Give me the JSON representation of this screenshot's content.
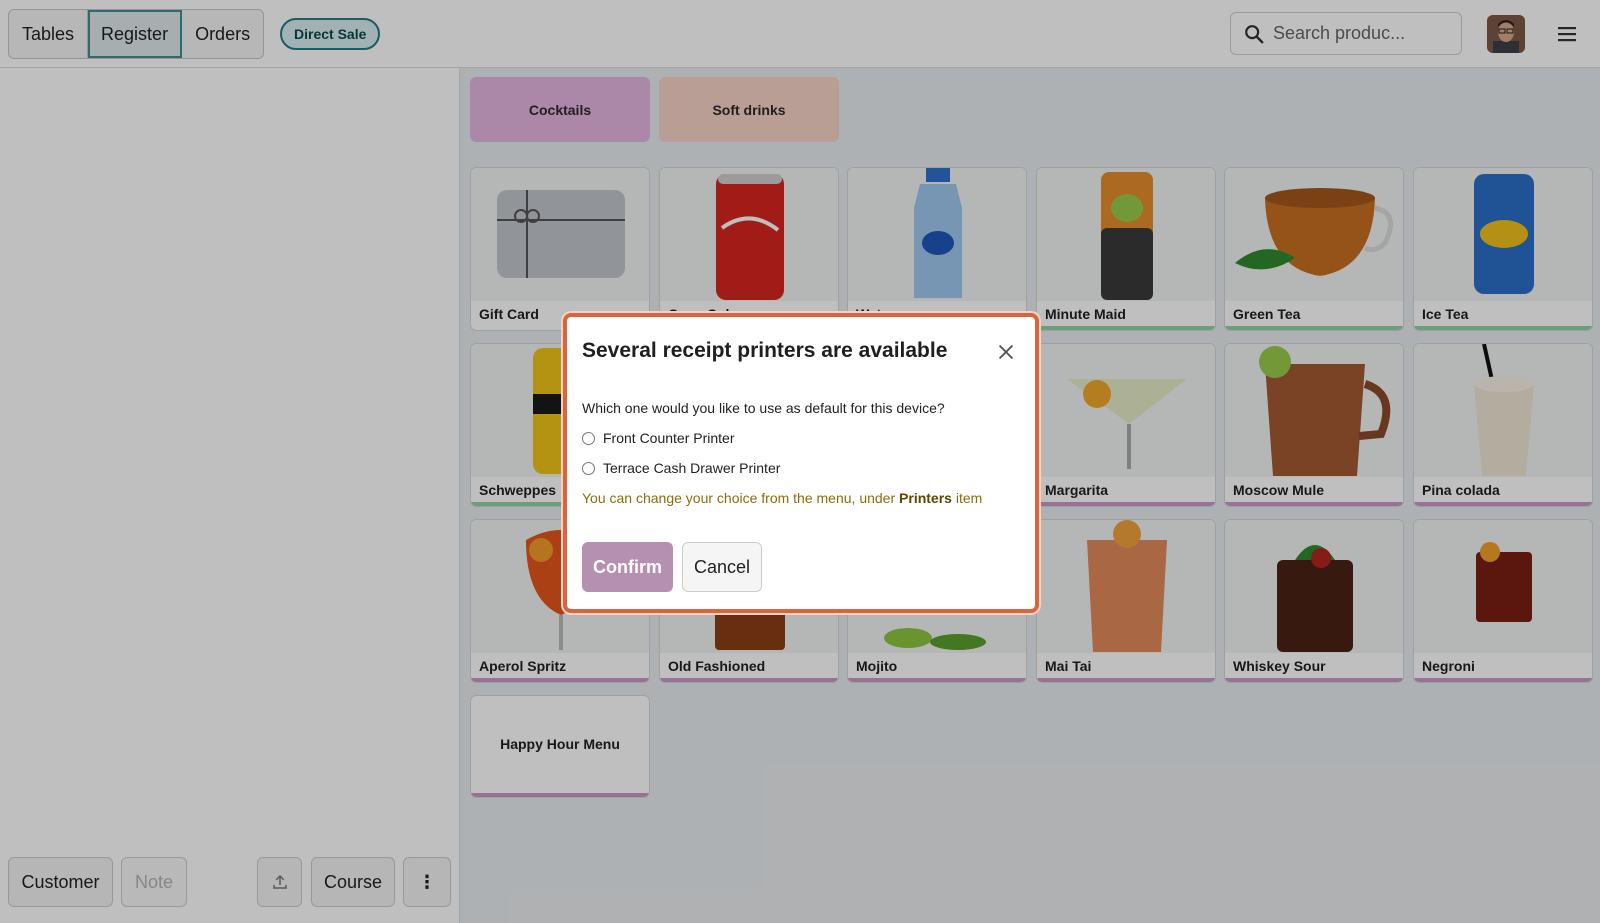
{
  "topbar": {
    "nav": [
      "Tables",
      "Register",
      "Orders"
    ],
    "active_nav": "Register",
    "direct_sale": "Direct Sale",
    "search_placeholder": "Search produc..."
  },
  "categories": [
    {
      "label": "Cocktails",
      "color": "#e5b6e1"
    },
    {
      "label": "Soft drinks",
      "color": "#f6d3c6"
    }
  ],
  "products": [
    {
      "name": "Gift Card",
      "bar": ""
    },
    {
      "name": "Coca-Cola",
      "bar": ""
    },
    {
      "name": "Water",
      "bar": ""
    },
    {
      "name": "Minute Maid",
      "bar": "#8fd3a3"
    },
    {
      "name": "Green Tea",
      "bar": "#8fd3a3"
    },
    {
      "name": "Ice Tea",
      "bar": "#8fd3a3"
    },
    {
      "name": "Schweppes",
      "bar": "#8fd3a3"
    },
    {
      "name": "Margarita",
      "bar": "#c99ac6"
    },
    {
      "name": "Moscow Mule",
      "bar": "#c99ac6"
    },
    {
      "name": "Pina colada",
      "bar": "#c99ac6"
    },
    {
      "name": "Aperol Spritz",
      "bar": "#c99ac6"
    },
    {
      "name": "Old Fashioned",
      "bar": "#c99ac6"
    },
    {
      "name": "Mojito",
      "bar": "#c99ac6"
    },
    {
      "name": "Mai Tai",
      "bar": "#c99ac6"
    },
    {
      "name": "Whiskey Sour",
      "bar": "#c99ac6"
    },
    {
      "name": "Negroni",
      "bar": "#c99ac6"
    },
    {
      "name": "Happy Hour Menu",
      "bar": "#c99ac6"
    }
  ],
  "bottom": {
    "customer": "Customer",
    "note": "Note",
    "course": "Course",
    "more": "⋮"
  },
  "dialog": {
    "title": "Several receipt printers are available",
    "question": "Which one would you like to use as default for this device?",
    "options": [
      "Front Counter Printer",
      "Terrace Cash Drawer Printer"
    ],
    "hint_prefix": "You can change your choice from the menu, under",
    "hint_bold": "Printers",
    "hint_suffix": "item",
    "confirm": "Confirm",
    "cancel": "Cancel"
  },
  "colors": {
    "accent": "#3f8f93",
    "dialog_border": "#d9653f",
    "confirm": "#b590b0"
  }
}
